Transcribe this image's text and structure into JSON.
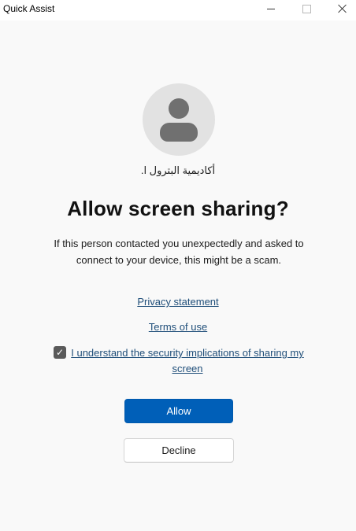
{
  "window": {
    "title": "Quick Assist"
  },
  "user": {
    "name": "أكاديمية البترول ا."
  },
  "prompt": {
    "heading": "Allow screen sharing?",
    "warning": "If this person contacted you unexpectedly and asked to connect to your device, this might be a scam."
  },
  "links": {
    "privacy": "Privacy statement",
    "terms": "Terms of use"
  },
  "consent": {
    "checked": true,
    "label": "I understand the security implications of sharing my screen"
  },
  "buttons": {
    "allow": "Allow",
    "decline": "Decline"
  },
  "colors": {
    "accent": "#005fb8",
    "link": "#1f4e79",
    "background": "#f9f9f9"
  }
}
